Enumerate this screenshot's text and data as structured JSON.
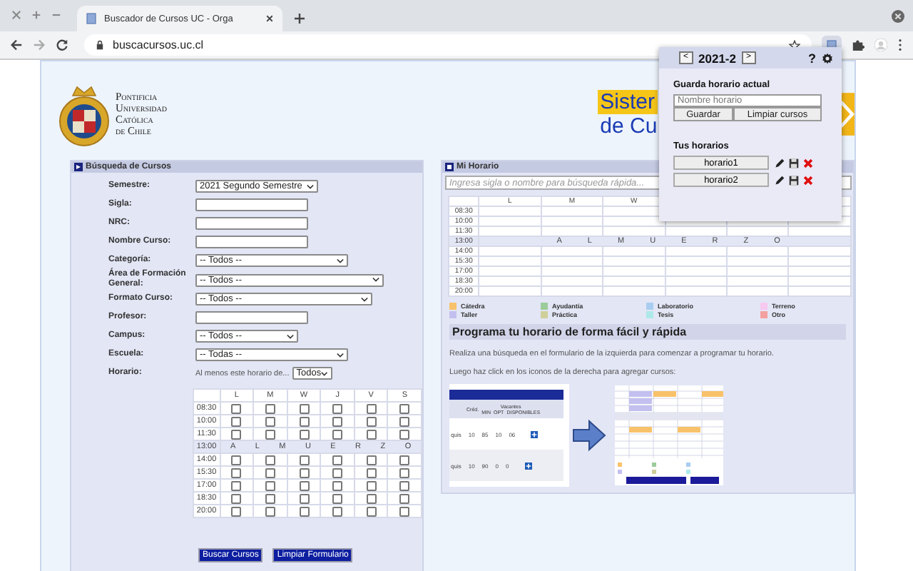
{
  "browser": {
    "tab_title": "Buscador de Cursos UC - Orga",
    "url": "buscacursos.uc.cl"
  },
  "logo": {
    "lines": [
      "Pontificia",
      "Universidad",
      "Católica",
      "de Chile"
    ]
  },
  "banner": {
    "line1": "Sister",
    "line2": "de Cu"
  },
  "search_panel": {
    "title": "Búsqueda de Cursos",
    "fields": [
      {
        "kind": "select",
        "label": "Semestre:",
        "value": "2021 Segundo Semestre"
      },
      {
        "kind": "input",
        "label": "Sigla:"
      },
      {
        "kind": "input",
        "label": "NRC:"
      },
      {
        "kind": "input",
        "label": "Nombre Curso:"
      },
      {
        "kind": "select",
        "label": "Categoría:",
        "value": "-- Todos --"
      },
      {
        "kind": "select",
        "label": "Área de Formación General:",
        "value": "-- Todos --"
      },
      {
        "kind": "select",
        "label": "Formato Curso:",
        "value": "-- Todos --"
      },
      {
        "kind": "input",
        "label": "Profesor:"
      },
      {
        "kind": "select",
        "label": "Campus:",
        "value": "-- Todos --"
      },
      {
        "kind": "select",
        "label": "Escuela:",
        "value": "-- Todas --"
      }
    ],
    "horario": {
      "label": "Horario:",
      "hint": "Al menos este horario de...",
      "value": "Todos"
    },
    "grid": {
      "days": [
        "L",
        "M",
        "W",
        "J",
        "V",
        "S"
      ],
      "lunch_time": "13:00",
      "lunch_letters": [
        "A",
        "L",
        "M",
        "U",
        "E",
        "R",
        "Z",
        "O"
      ],
      "rows": [
        {
          "time": "08:30",
          "checked": [
            false,
            false,
            false,
            false,
            false,
            false
          ]
        },
        {
          "time": "10:00",
          "checked": [
            false,
            false,
            false,
            false,
            false,
            false
          ]
        },
        {
          "time": "11:30",
          "checked": [
            false,
            false,
            false,
            false,
            false,
            false
          ]
        },
        {
          "time": "14:00",
          "checked": [
            false,
            false,
            false,
            false,
            false,
            false
          ]
        },
        {
          "time": "15:30",
          "checked": [
            false,
            false,
            false,
            false,
            false,
            false
          ]
        },
        {
          "time": "17:00",
          "checked": [
            false,
            false,
            false,
            false,
            false,
            false
          ]
        },
        {
          "time": "18:30",
          "checked": [
            false,
            false,
            false,
            false,
            false,
            false
          ]
        },
        {
          "time": "20:00",
          "checked": [
            false,
            false,
            false,
            false,
            false,
            false
          ]
        }
      ]
    },
    "buttons": [
      "Buscar Cursos",
      "Limpiar Formulario"
    ]
  },
  "schedule_panel": {
    "title": "Mi Horario",
    "search_placeholder": "Ingresa sigla o nombre para búsqueda rápida...",
    "days": [
      "L",
      "M",
      "W"
    ],
    "times_before": [
      "08:30",
      "10:00",
      "11:30"
    ],
    "lunch_time": "13:00",
    "lunch_letters": [
      "A",
      "L",
      "M",
      "U",
      "E",
      "R",
      "Z",
      "O"
    ],
    "times_after": [
      "14:00",
      "15:30",
      "17:00",
      "18:30",
      "20:00"
    ],
    "legend": [
      {
        "label": "Cátedra",
        "color": "#f7c26a"
      },
      {
        "label": "Ayudantía",
        "color": "#9ccc9a"
      },
      {
        "label": "Laboratorio",
        "color": "#a9cdf0"
      },
      {
        "label": "Terreno",
        "color": "#f7c9f1"
      },
      {
        "label": "Taller",
        "color": "#c3c0f0"
      },
      {
        "label": "Práctica",
        "color": "#cfcf9c"
      },
      {
        "label": "Tesis",
        "color": "#aee9ea"
      },
      {
        "label": "Otro",
        "color": "#f4a0a0"
      }
    ],
    "heading": "Programa tu horario de forma fácil y rápida",
    "paragraphs": [
      "Realiza una búsqueda en el formulario de la izquierda para comenzar a programar tu horario.",
      "Luego haz click en los iconos de la derecha para agregar cursos:"
    ],
    "tutorial": {
      "header": [
        "Créd.",
        "Vacantes",
        "MIN",
        "OPT",
        "DISPONIBLES"
      ],
      "rows": [
        [
          "quis",
          "10",
          "85",
          "10",
          "06"
        ],
        [
          "quis",
          "10",
          "90",
          "0",
          "0"
        ]
      ]
    }
  },
  "popup": {
    "prev": "<",
    "semester": "2021-2",
    "next": ">",
    "help": "?",
    "save_title": "Guarda horario actual",
    "name_placeholder": "Nombre horario",
    "save": "Guardar",
    "clear": "Limpiar cursos",
    "list_title": "Tus horarios",
    "schedules": [
      "horario1",
      "horario2"
    ]
  }
}
